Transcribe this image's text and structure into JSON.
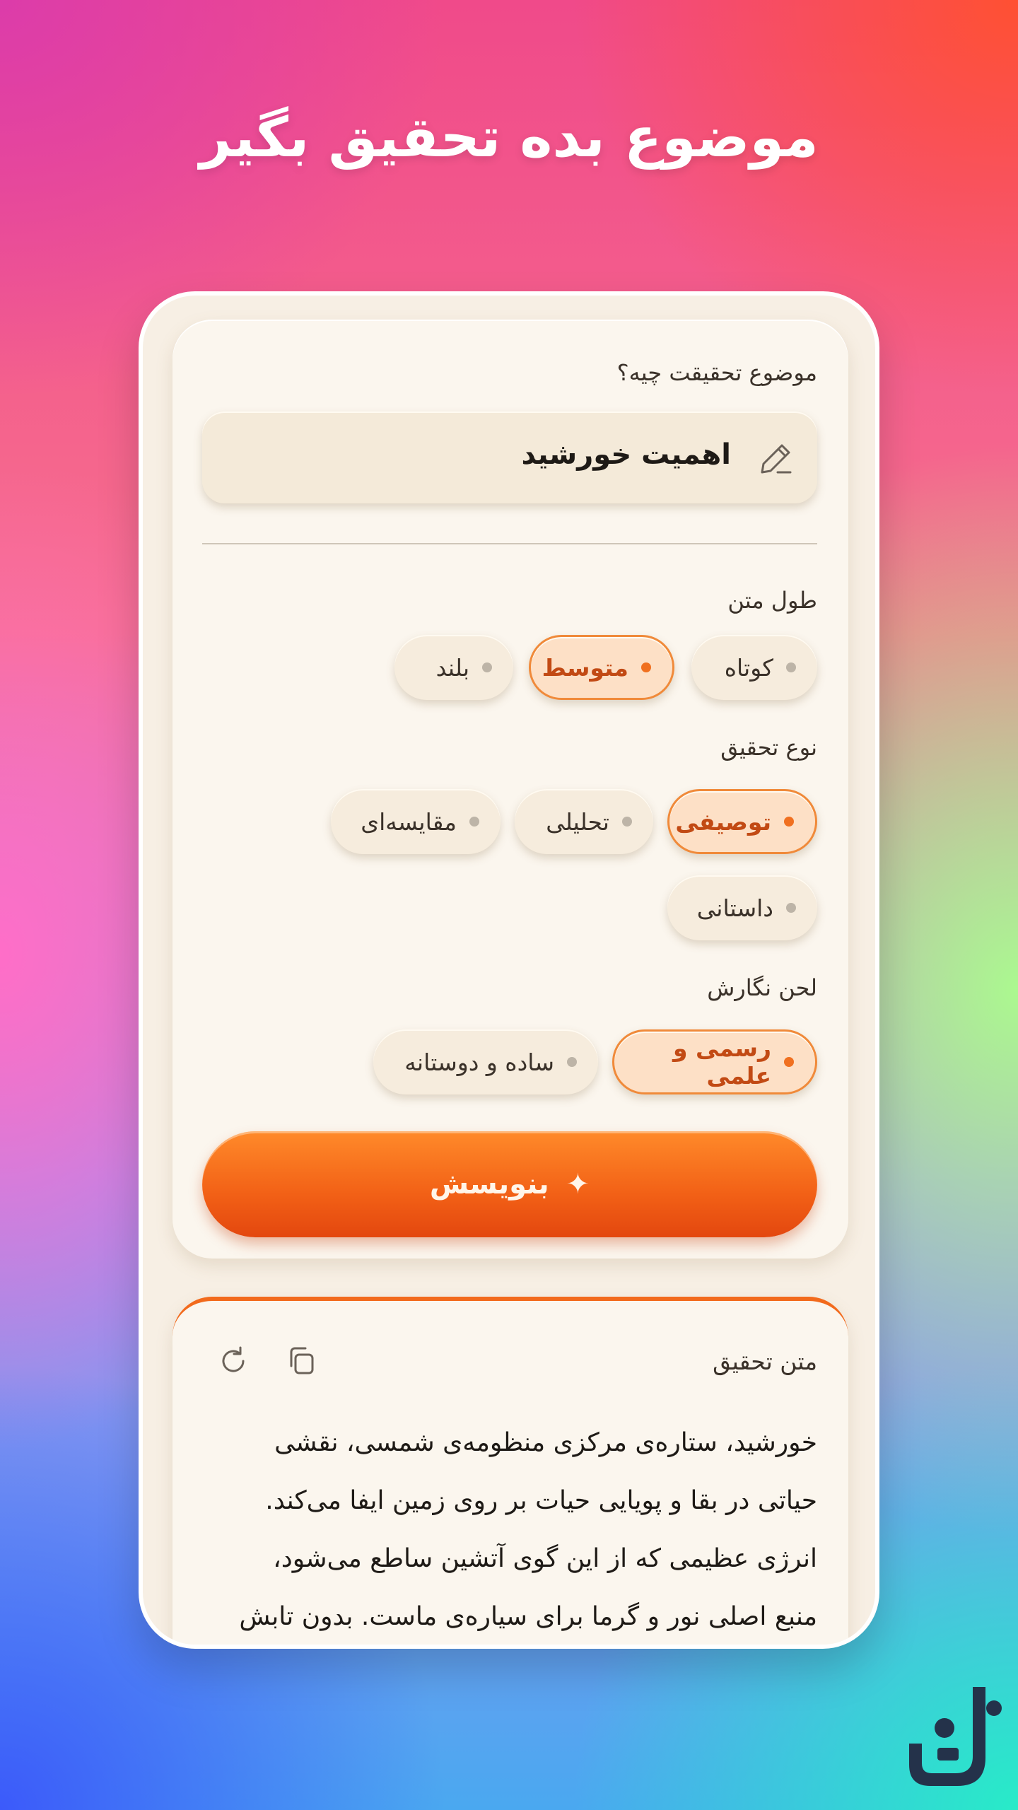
{
  "header": {
    "title": "موضوع بده تحقیق بگیر"
  },
  "form": {
    "topic_label": "موضوع تحقیقت چیه؟",
    "topic_value": "اهمیت خورشید",
    "length": {
      "label": "طول متن",
      "options": [
        "کوتاه",
        "متوسط",
        "بلند"
      ],
      "selected": "متوسط"
    },
    "type": {
      "label": "نوع تحقیق",
      "options": [
        "توصیفی",
        "تحلیلی",
        "مقایسه‌ای",
        "داستانی"
      ],
      "selected": "توصیفی"
    },
    "tone": {
      "label": "لحن نگارش",
      "options": [
        "رسمی و علمی",
        "ساده و دوستانه"
      ],
      "selected": "رسمی و علمی"
    },
    "submit_label": "بنویسش",
    "submit_icon": "sparkle-icon"
  },
  "result": {
    "title": "متن تحقیق",
    "lines": [
      "خورشید، ستاره‌ی مرکزی منظومه‌ی شمسی، نقشی",
      "حیاتی در بقا و پویایی حیات بر روی زمین ایفا می‌کند.",
      "انرژی عظیمی که از این گوی آتشین ساطع می‌شود،",
      "منبع اصلی نور و گرما برای سیاره‌ی ماست. بدون تابش"
    ]
  },
  "colors": {
    "accent": "#f26016",
    "accent_light": "#fde0c6",
    "card": "#fbf6ee"
  }
}
